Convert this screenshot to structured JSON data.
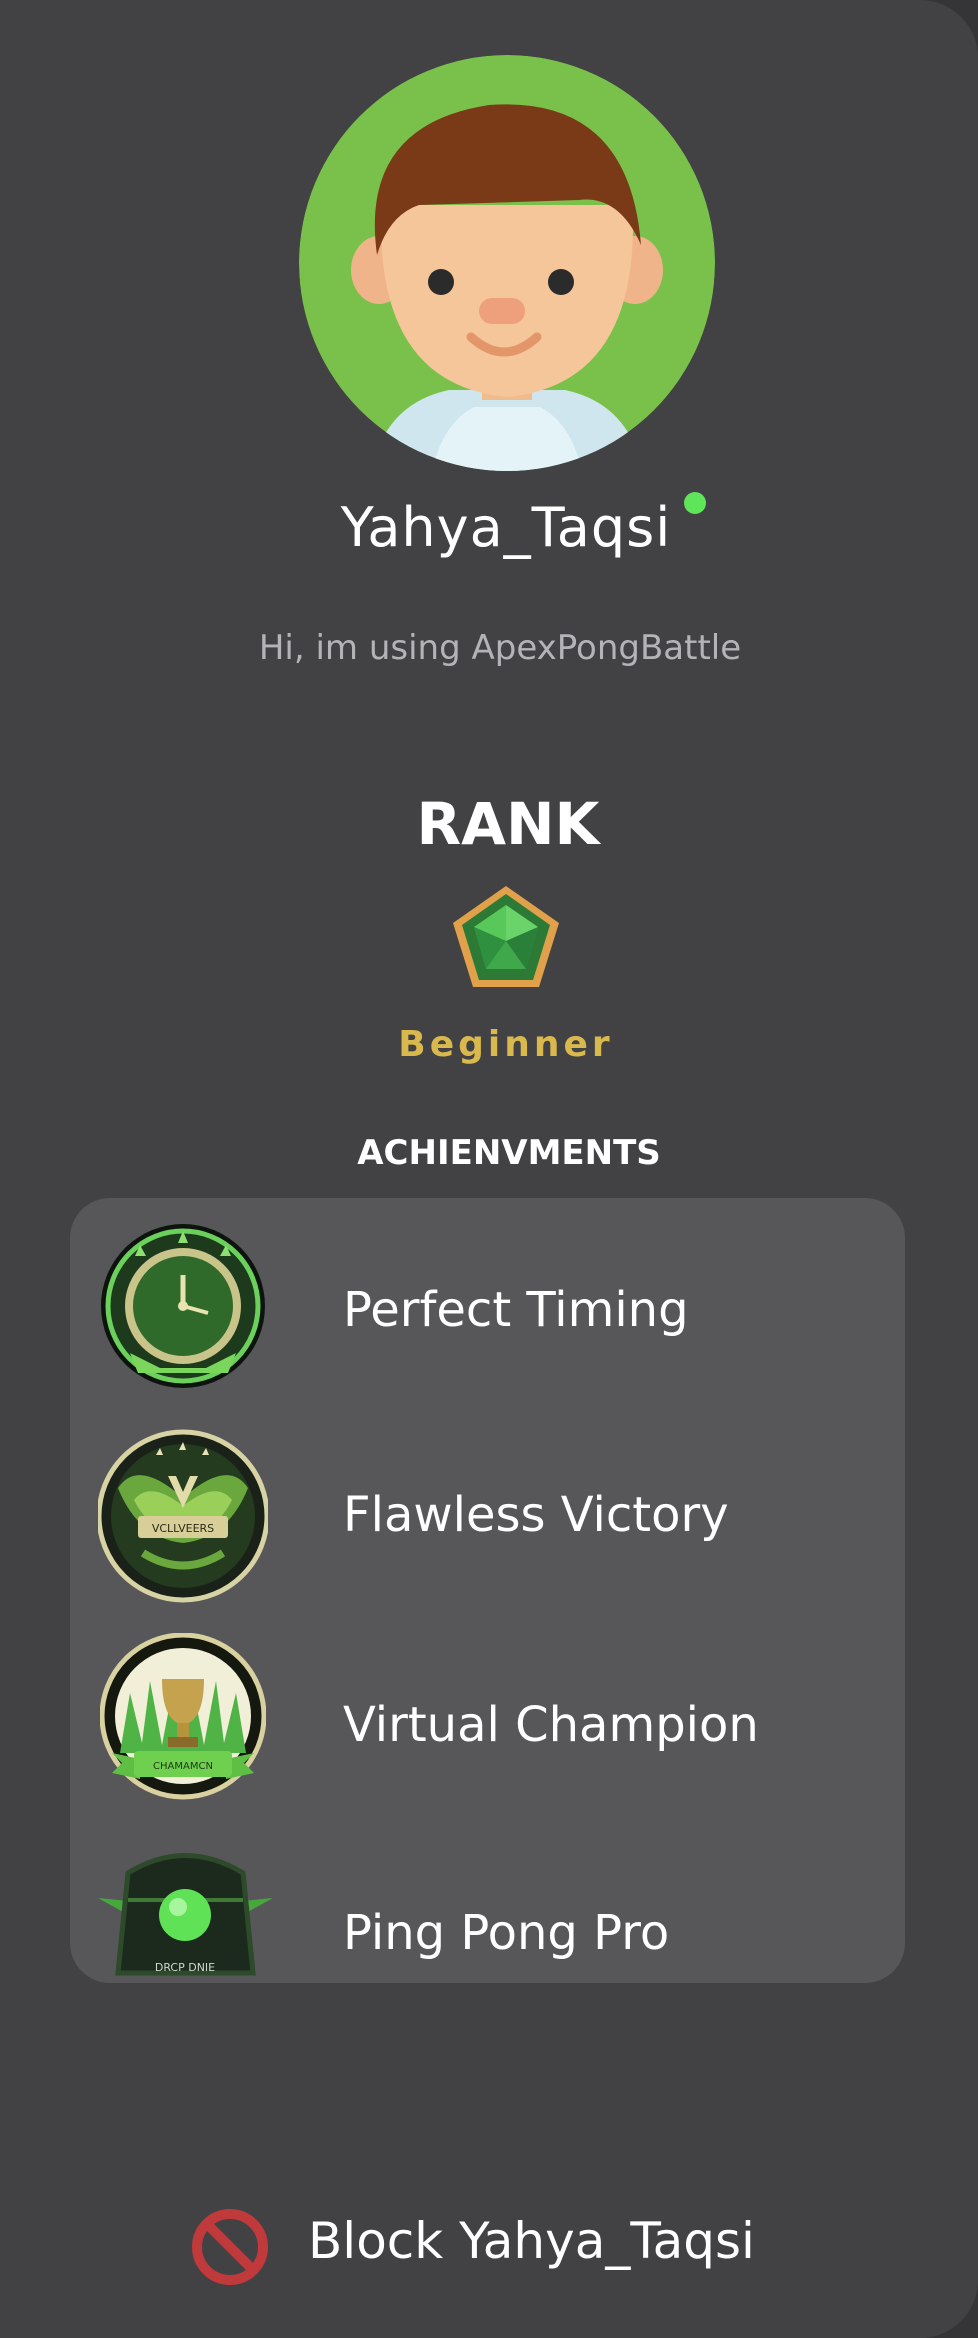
{
  "profile": {
    "username": "Yahya_Taqsi",
    "status_message": "Hi, im using ApexPongBattle",
    "online": true,
    "avatar_icon": "boy-avatar-icon"
  },
  "rank": {
    "title": "RANK",
    "name": "Beginner",
    "icon": "green-gem-icon"
  },
  "achievements": {
    "title": "ACHIENVMENTS",
    "items": [
      {
        "label": "Perfect Timing",
        "icon": "clock-badge-icon",
        "badge_text": ""
      },
      {
        "label": "Flawless Victory",
        "icon": "winged-badge-icon",
        "badge_text": "VCLLVEERS"
      },
      {
        "label": "Virtual Champion",
        "icon": "trophy-badge-icon",
        "badge_text": "CHAMAMCN"
      },
      {
        "label": "Ping Pong Pro",
        "icon": "ball-badge-icon",
        "badge_text": "DRCP DNIE"
      }
    ]
  },
  "actions": {
    "block_label": "Block Yahya_Taqsi",
    "block_icon": "block-icon"
  },
  "colors": {
    "panel_bg": "#424244",
    "card_bg": "#575759",
    "online": "#5fe55a",
    "rank_gold": "#d9b94e",
    "block_red": "#c0393b"
  }
}
